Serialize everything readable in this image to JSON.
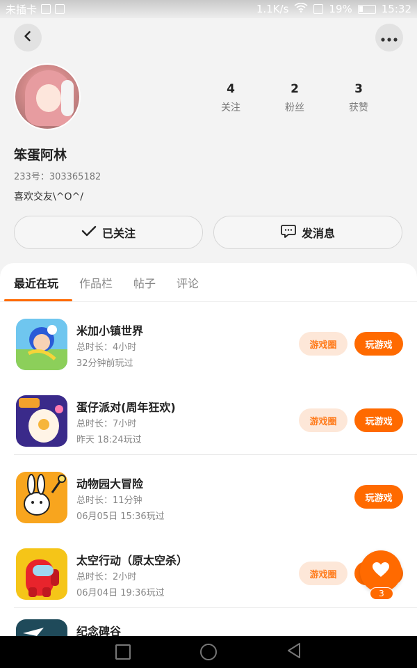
{
  "status_bar": {
    "carrier": "未插卡",
    "speed": "1.1K/s",
    "battery": "19%",
    "time": "15:32"
  },
  "profile": {
    "stats": [
      {
        "value": "4",
        "label": "关注"
      },
      {
        "value": "2",
        "label": "粉丝"
      },
      {
        "value": "3",
        "label": "获赞"
      }
    ],
    "username": "笨蛋阿林",
    "uid": "233号：303365182",
    "bio": "喜欢交友\\^O^/",
    "follow_label": "已关注",
    "message_label": "发消息"
  },
  "tabs": [
    "最近在玩",
    "作品栏",
    "帖子",
    "评论"
  ],
  "games": [
    {
      "name": "米加小镇世界",
      "duration": "总时长：4小时",
      "last_played": "32分钟前玩过",
      "circle_label": "游戏圈",
      "play_label": "玩游戏"
    },
    {
      "name": "蛋仔派对(周年狂欢)",
      "duration": "总时长：7小时",
      "last_played": "昨天 18:24玩过",
      "circle_label": "游戏圈",
      "play_label": "玩游戏"
    },
    {
      "name": "动物园大冒险",
      "duration": "总时长：11分钟",
      "last_played": "06月05日 15:36玩过",
      "play_label": "玩游戏"
    },
    {
      "name": "太空行动（原太空杀）",
      "duration": "总时长：2小时",
      "last_played": "06月04日 19:36玩过",
      "circle_label": "游戏圈",
      "play_label": "玩游戏"
    },
    {
      "name": "纪念碑谷"
    }
  ],
  "like_fab": {
    "count": "3"
  },
  "colors": {
    "accent": "#ff6a00",
    "accent_light": "#fde7d8"
  },
  "icons": [
    "back-icon",
    "more-icon",
    "check-icon",
    "chat-icon",
    "heart-icon"
  ]
}
